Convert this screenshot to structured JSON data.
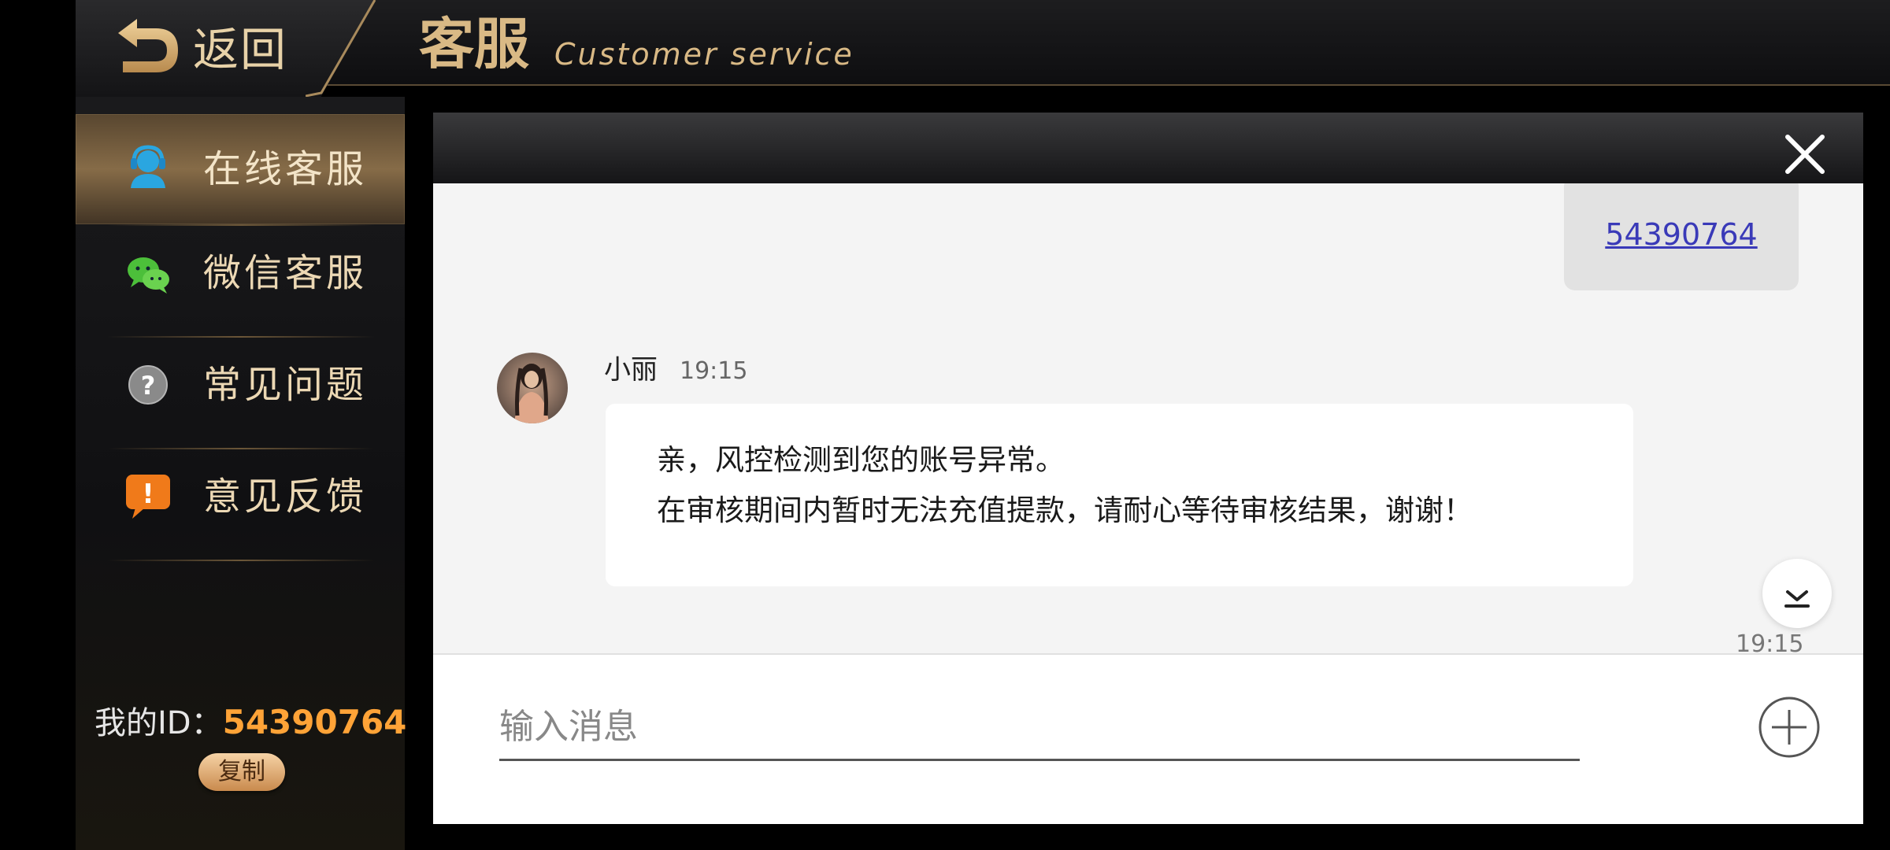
{
  "header": {
    "back_label": "返回",
    "title_cn": "客服",
    "title_en": "Customer service"
  },
  "sidebar": {
    "items": [
      {
        "label": "在线客服",
        "icon": "agent-headset-icon",
        "active": true
      },
      {
        "label": "微信客服",
        "icon": "wechat-icon",
        "active": false
      },
      {
        "label": "常见问题",
        "icon": "question-icon",
        "active": false
      },
      {
        "label": "意见反馈",
        "icon": "feedback-exclamation-icon",
        "active": false
      }
    ],
    "my_id_label": "我的ID：",
    "my_id_value": "54390764",
    "copy_label": "复制"
  },
  "chat": {
    "sent_message": "54390764",
    "received": {
      "sender": "小丽",
      "time": "19:15",
      "lines": [
        "亲，风控检测到您的账号异常。",
        "在审核期间内暂时无法充值提款，请耐心等待审核结果，谢谢！"
      ]
    },
    "bottom_time": "19:15",
    "input_placeholder": "输入消息"
  },
  "colors": {
    "gold_text": "#d9b985",
    "id_orange": "#ffa337",
    "link_blue": "#3a3ab8"
  }
}
